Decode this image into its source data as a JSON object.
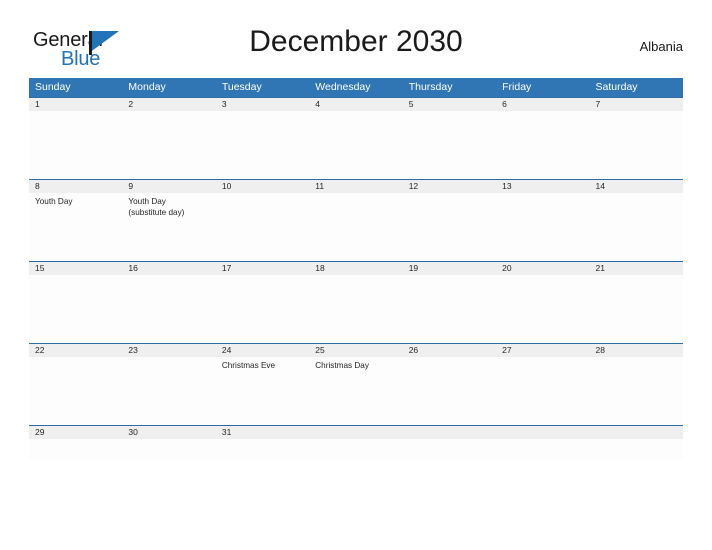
{
  "brand": {
    "name_part1": "General",
    "name_part2": "Blue",
    "flag_icon": "blue-flag-icon",
    "accent_color": "#2273b8"
  },
  "header": {
    "title": "December 2030",
    "country": "Albania"
  },
  "theme": {
    "header_blue": "#3075b4",
    "row_divider_blue": "#2e6da4",
    "date_band_gray": "#efefef",
    "text_color": "#262626"
  },
  "calendar": {
    "month": "December",
    "year": "2030",
    "weekday_headers": [
      "Sunday",
      "Monday",
      "Tuesday",
      "Wednesday",
      "Thursday",
      "Friday",
      "Saturday"
    ],
    "weeks": [
      {
        "dates": [
          "1",
          "2",
          "3",
          "4",
          "5",
          "6",
          "7"
        ],
        "events": [
          [],
          [],
          [],
          [],
          [],
          [],
          []
        ]
      },
      {
        "dates": [
          "8",
          "9",
          "10",
          "11",
          "12",
          "13",
          "14"
        ],
        "events": [
          [
            "Youth Day"
          ],
          [
            "Youth Day",
            "(substitute day)"
          ],
          [],
          [],
          [],
          [],
          []
        ]
      },
      {
        "dates": [
          "15",
          "16",
          "17",
          "18",
          "19",
          "20",
          "21"
        ],
        "events": [
          [],
          [],
          [],
          [],
          [],
          [],
          []
        ]
      },
      {
        "dates": [
          "22",
          "23",
          "24",
          "25",
          "26",
          "27",
          "28"
        ],
        "events": [
          [],
          [],
          [
            "Christmas Eve"
          ],
          [
            "Christmas Day"
          ],
          [],
          [],
          []
        ]
      },
      {
        "dates": [
          "29",
          "30",
          "31",
          "",
          "",
          "",
          ""
        ],
        "events": [
          [],
          [],
          [],
          [],
          [],
          [],
          []
        ]
      }
    ]
  }
}
